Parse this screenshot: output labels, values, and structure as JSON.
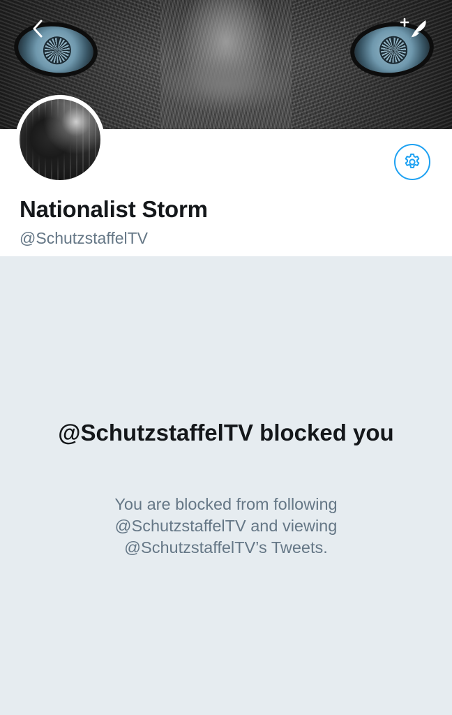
{
  "profile": {
    "display_name": "Nationalist Storm",
    "handle": "@SchutzstaffelTV"
  },
  "blocked": {
    "title": "@SchutzstaffelTV blocked you",
    "description": "You are blocked from following @SchutzstaffelTV and viewing @SchutzstaffelTV’s Tweets."
  },
  "icons": {
    "back": "chevron-left-icon",
    "compose": "compose-tweet-icon",
    "settings": "gear-icon"
  },
  "colors": {
    "accent": "#1da1f2",
    "text_primary": "#14171a",
    "text_secondary": "#657786",
    "background": "#e6ecf0"
  }
}
